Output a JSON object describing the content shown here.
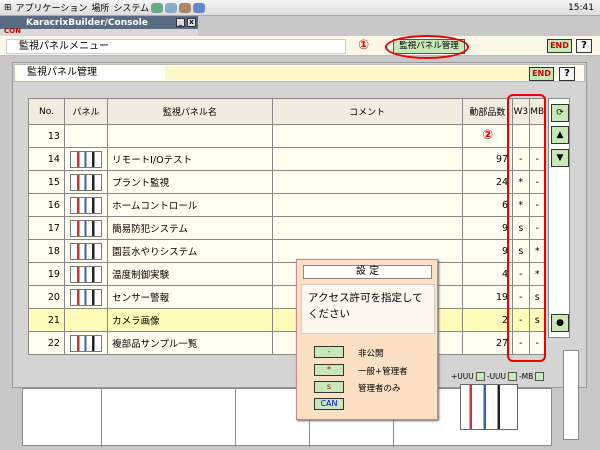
{
  "topbar": {
    "menus": [
      "アプリケーション",
      "場所",
      "システム"
    ],
    "clock": "15:41"
  },
  "window": {
    "title": "KaracrixBuilder/Console",
    "con": "CON"
  },
  "menu": {
    "title": "監視パネルメニュー",
    "circled_one": "①",
    "active_item": "監視パネル管理",
    "end_label": "END",
    "help_label": "?"
  },
  "panel": {
    "title": "監視パネル管理",
    "end_label": "END",
    "help_label": "?",
    "circled_two": "②",
    "columns": [
      "No.",
      "パネル",
      "監視パネル名",
      "コメント",
      "動部品数",
      "W3",
      "MB"
    ],
    "rows": [
      {
        "no": "13",
        "name": "",
        "count": "",
        "w3": "",
        "mb": "",
        "thumb": false
      },
      {
        "no": "14",
        "name": "リモートI/Oテスト",
        "count": "97",
        "w3": "-",
        "mb": "-",
        "thumb": true
      },
      {
        "no": "15",
        "name": "プラント監視",
        "count": "24",
        "w3": "*",
        "mb": "-",
        "thumb": true
      },
      {
        "no": "16",
        "name": "ホームコントロール",
        "count": "6",
        "w3": "*",
        "mb": "-",
        "thumb": true
      },
      {
        "no": "17",
        "name": "簡易防犯システム",
        "count": "9",
        "w3": "s",
        "mb": "-",
        "thumb": true
      },
      {
        "no": "18",
        "name": "園芸水やりシステム",
        "count": "9",
        "w3": "s",
        "mb": "*",
        "thumb": true
      },
      {
        "no": "19",
        "name": "温度制御実験",
        "count": "4",
        "w3": "-",
        "mb": "*",
        "thumb": true
      },
      {
        "no": "20",
        "name": "センサー警報",
        "count": "19",
        "w3": "-",
        "mb": "s",
        "thumb": true
      },
      {
        "no": "21",
        "name": "カメラ画像",
        "count": "2",
        "w3": "-",
        "mb": "s",
        "thumb": false,
        "highlight": true
      },
      {
        "no": "22",
        "name": "複部品サンプル一覧",
        "count": "27",
        "w3": "-",
        "mb": "-",
        "thumb": true
      }
    ],
    "footer": {
      "w3_label": "+UUU",
      "uuu_label": "-UUU",
      "mb_label": "-MB"
    }
  },
  "dialog": {
    "title": "設 定",
    "message": "アクセス許可を指定してください",
    "options": [
      {
        "button": "-",
        "label": "非公開"
      },
      {
        "button": "*",
        "label": "一般+管理者"
      },
      {
        "button": "s",
        "label": "管理者のみ"
      }
    ],
    "cancel_label": "CAN"
  },
  "sidebar_icons": [
    "refresh-icon",
    "up-arrow-icon",
    "down-arrow-icon",
    "dot-icon"
  ]
}
